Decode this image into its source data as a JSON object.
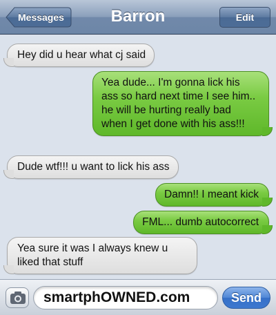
{
  "header": {
    "title": "Barron",
    "back_label": "Messages",
    "edit_label": "Edit"
  },
  "messages": [
    {
      "from": "received",
      "text": "Hey did u hear what cj said"
    },
    {
      "from": "sent",
      "text": "Yea dude... I'm gonna lick his ass so hard next time I see him.. he will be hurting really bad when I get done with his ass!!!"
    },
    {
      "from": "received",
      "text": "Dude wtf!!! u want to lick his ass"
    },
    {
      "from": "sent",
      "text": "Damn!! I meant kick"
    },
    {
      "from": "sent",
      "text": "FML... dumb autocorrect"
    },
    {
      "from": "received",
      "text": "Yea sure it was I always knew u liked that stuff"
    }
  ],
  "composer": {
    "value": "smartphOWNED.com",
    "send_label": "Send"
  },
  "icons": {
    "camera": "camera-icon",
    "back_arrow": "back-arrow-icon"
  },
  "colors": {
    "sent_bubble": "#7acb43",
    "received_bubble": "#e8e8e8",
    "nav_bar": "#7189aa",
    "send_button": "#3d78cf"
  }
}
